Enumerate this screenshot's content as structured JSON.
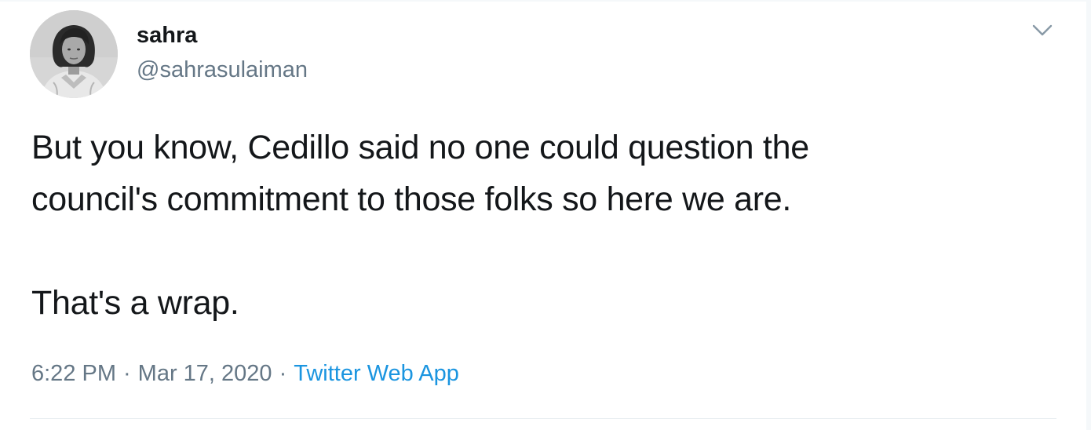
{
  "author": {
    "display_name": "sahra",
    "handle": "@sahrasulaiman",
    "avatar_icon": "profile-photo-avatar"
  },
  "menu": {
    "icon": "chevron-down-icon"
  },
  "tweet": {
    "lines": [
      "But you know, Cedillo said no one could question the",
      "council's commitment to those folks so here we are.",
      "That's a wrap."
    ]
  },
  "meta": {
    "time": "6:22 PM",
    "separator": "·",
    "date": "Mar 17, 2020",
    "source": "Twitter Web App"
  },
  "colors": {
    "text": "#14171a",
    "secondary": "#657786",
    "link": "#1b95e0",
    "divider": "#e6ecf0"
  }
}
